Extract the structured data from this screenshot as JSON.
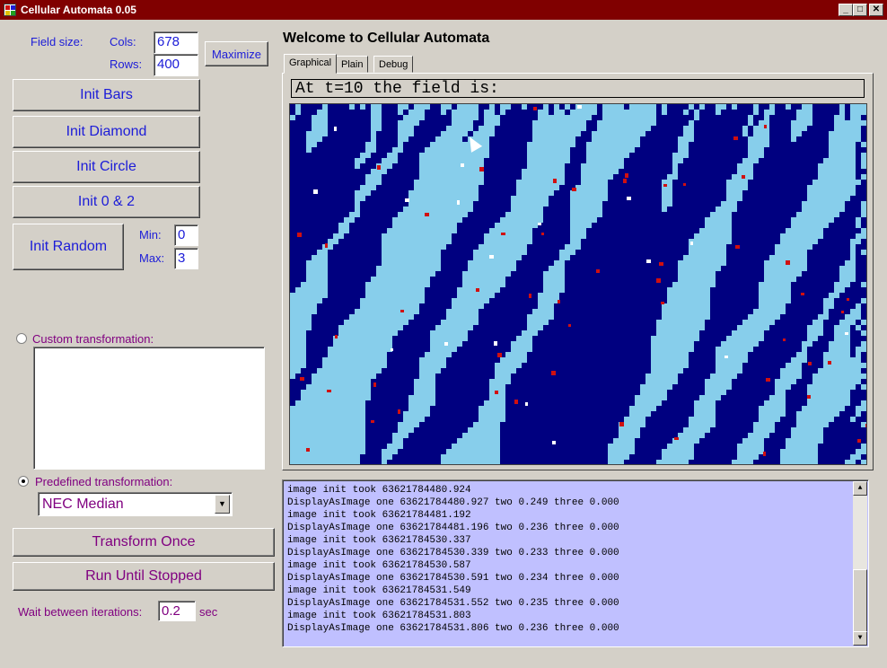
{
  "window": {
    "title": "Cellular Automata 0.05"
  },
  "controls": {
    "field_size_label": "Field size:",
    "cols_label": "Cols:",
    "cols_value": "678",
    "rows_label": "Rows:",
    "rows_value": "400",
    "maximize_label": "Maximize",
    "init_bars": "Init Bars",
    "init_diamond": "Init Diamond",
    "init_circle": "Init Circle",
    "init_0_2": "Init 0 & 2",
    "init_random": "Init Random",
    "min_label": "Min:",
    "min_value": "0",
    "max_label": "Max:",
    "max_value": "3",
    "custom_label": "Custom transformation:",
    "custom_value": "",
    "predefined_label": "Predefined transformation:",
    "predefined_value": "NEC Median",
    "transform_once": "Transform Once",
    "run_until_stopped": "Run Until Stopped",
    "wait_label": "Wait between iterations:",
    "wait_value": "0.2",
    "wait_unit": "sec",
    "custom_selected": false,
    "predefined_selected": true
  },
  "main": {
    "heading": "Welcome to Cellular Automata",
    "tabs": [
      {
        "label": "Graphical",
        "active": true
      },
      {
        "label": "Plain",
        "active": false
      },
      {
        "label": "Debug",
        "active": false
      }
    ],
    "banner": "At t=10 the field is:",
    "colors": {
      "background": "#000080",
      "light": "#87ceeb",
      "accent": "#d01010",
      "spot": "#ffffff"
    }
  },
  "log": {
    "lines": [
      "image init took 63621784480.924",
      "DisplayAsImage one 63621784480.927 two 0.249 three 0.000",
      "image init took 63621784481.192",
      "DisplayAsImage one 63621784481.196 two 0.236 three 0.000",
      "image init took 63621784530.337",
      "DisplayAsImage one 63621784530.339 two 0.233 three 0.000",
      "image init took 63621784530.587",
      "DisplayAsImage one 63621784530.591 two 0.234 three 0.000",
      "image init took 63621784531.549",
      "DisplayAsImage one 63621784531.552 two 0.235 three 0.000",
      "image init took 63621784531.803",
      "DisplayAsImage one 63621784531.806 two 0.236 three 0.000"
    ]
  }
}
